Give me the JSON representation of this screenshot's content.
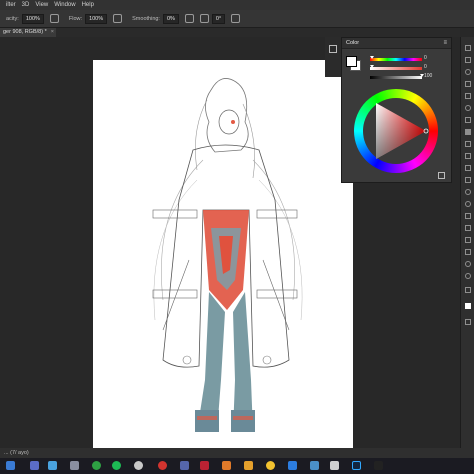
{
  "menubar": {
    "items": [
      "ilter",
      "3D",
      "View",
      "Window",
      "Help"
    ]
  },
  "options": {
    "opacity_label": "acity:",
    "opacity_value": "100%",
    "flow_label": "Flow:",
    "flow_value": "100%",
    "smoothing_label": "Smoothing:",
    "smoothing_value": "0%",
    "angle_value": "0°"
  },
  "document_tab": {
    "title": "ger 908, RGB/8) *",
    "close": "×"
  },
  "statusbar": {
    "text": "... (7/ ayo)"
  },
  "color_panel": {
    "title": "Color",
    "menu_icon": "≡",
    "sliders": [
      {
        "label": "",
        "value": "0",
        "color": "hue"
      },
      {
        "label": "",
        "value": "0",
        "color": "#e03a30"
      },
      {
        "label": "",
        "value": "100",
        "color": "#ffffff"
      }
    ],
    "foreground_color": "#ffffff",
    "background_color": "#ffffff",
    "footer_icon": "grid-icon"
  },
  "taskbar": {
    "icons": [
      "windows-icon",
      "task-view-icon",
      "store-icon",
      "shield-icon",
      "media-icon",
      "spotify-icon",
      "steam-icon",
      "opera-icon",
      "app-icon",
      "app-icon",
      "app-icon",
      "app-icon",
      "chrome-icon",
      "app-icon",
      "app-icon",
      "app-icon",
      "photoshop-icon",
      "app-icon"
    ]
  },
  "colors": {
    "accent": "#e03a30",
    "panel": "#3a3a3a",
    "background": "#282828"
  }
}
